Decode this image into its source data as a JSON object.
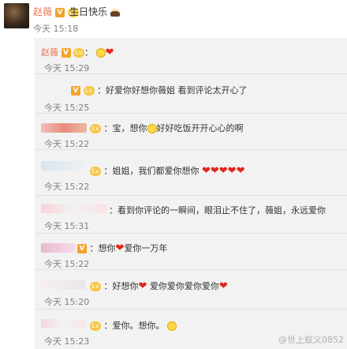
{
  "top": {
    "name": "赵薇",
    "badge_v": "V",
    "level": "Lv",
    "message": "生日快乐",
    "time": "今天 15:18"
  },
  "rows": [
    {
      "name": "赵薇",
      "time": "今天 15:29"
    },
    {
      "text": "：好爱你好想你薇姐 看到评论太开心了",
      "time": "今天 15:25"
    },
    {
      "text": "：宝，想你",
      "text2": "好好吃饭开开心心的啊",
      "time": "今天 15:22"
    },
    {
      "text": "：姐姐，我们都爱你想你",
      "time": "今天 15:22"
    },
    {
      "text": "：看到你评论的一瞬间，眼泪止不住了，薇姐，永远爱你",
      "time": "今天 15:31"
    },
    {
      "text": "：想你",
      "text2": "爱你一万年",
      "time": "今天 15:22"
    },
    {
      "text": "：好想你",
      "text2": "爱你爱你爱你爱你",
      "time": "今天 15:20"
    },
    {
      "text": "：爱你。想你。",
      "time": "今天 15:23"
    }
  ],
  "watermark": "@世上蚁义0852"
}
